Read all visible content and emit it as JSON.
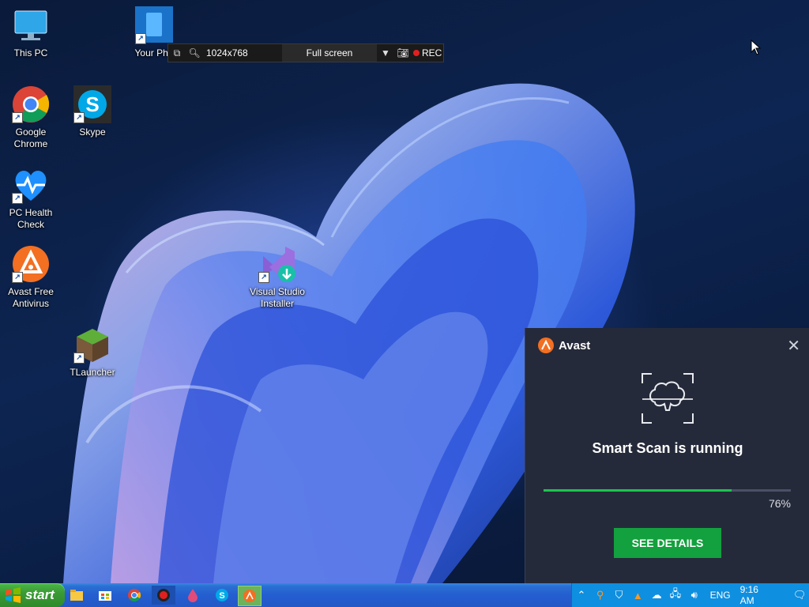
{
  "desktop": {
    "icons": [
      {
        "label": "This PC"
      },
      {
        "label": "Your Pho"
      },
      {
        "label": "Google Chrome"
      },
      {
        "label": "Skype"
      },
      {
        "label": "PC Health Check"
      },
      {
        "label": "Avast Free Antivirus"
      },
      {
        "label": "Visual Studio Installer"
      },
      {
        "label": "TLauncher"
      }
    ]
  },
  "recorder": {
    "resolution": "1024x768",
    "mode": "Full screen",
    "rec_label": "REC"
  },
  "avast_popup": {
    "brand": "Avast",
    "status_title": "Smart Scan is running",
    "progress_percent": 76,
    "progress_label": "76%",
    "details_button": "SEE DETAILS",
    "accent_color": "#13a03e"
  },
  "taskbar": {
    "start_label": "start",
    "language": "ENG",
    "clock": "9:16 AM",
    "pinned": [
      "file-explorer-icon",
      "windows-store-icon",
      "chrome-icon",
      "recorder-icon",
      "droplet-app-icon",
      "skype-icon",
      "avast-icon"
    ]
  }
}
